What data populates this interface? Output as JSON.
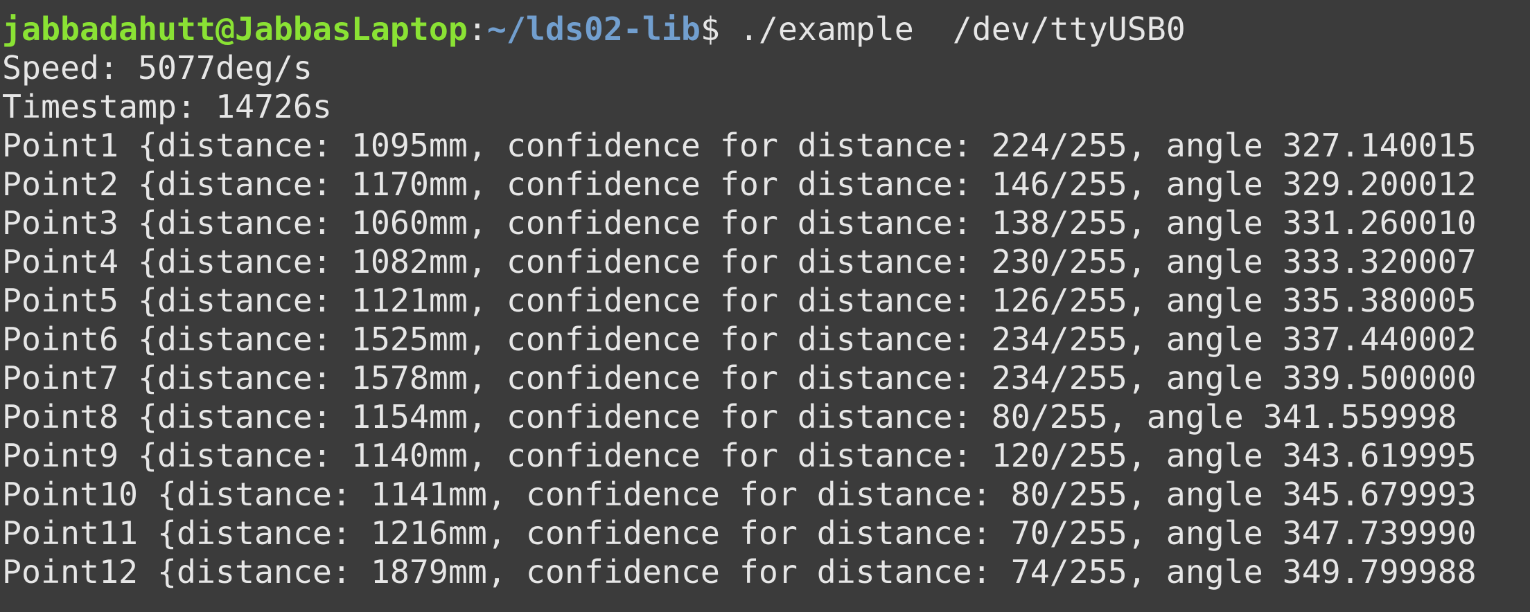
{
  "prompt": {
    "user_host": "jabbadahutt@JabbasLaptop",
    "separator": ":",
    "path": "~/lds02-lib",
    "dollar": "$ ",
    "command": "./example  /dev/ttyUSB0"
  },
  "output": [
    "Speed: 5077deg/s",
    "Timestamp: 14726s",
    "Point1 {distance: 1095mm, confidence for distance: 224/255, angle 327.140015",
    "Point2 {distance: 1170mm, confidence for distance: 146/255, angle 329.200012",
    "Point3 {distance: 1060mm, confidence for distance: 138/255, angle 331.260010",
    "Point4 {distance: 1082mm, confidence for distance: 230/255, angle 333.320007",
    "Point5 {distance: 1121mm, confidence for distance: 126/255, angle 335.380005",
    "Point6 {distance: 1525mm, confidence for distance: 234/255, angle 337.440002",
    "Point7 {distance: 1578mm, confidence for distance: 234/255, angle 339.500000",
    "Point8 {distance: 1154mm, confidence for distance: 80/255, angle 341.559998",
    "Point9 {distance: 1140mm, confidence for distance: 120/255, angle 343.619995",
    "Point10 {distance: 1141mm, confidence for distance: 80/255, angle 345.679993",
    "Point11 {distance: 1216mm, confidence for distance: 70/255, angle 347.739990",
    "Point12 {distance: 1879mm, confidence for distance: 74/255, angle 349.799988"
  ],
  "colors": {
    "background": "#3b3b3b",
    "text": "#e6e6e6",
    "user_host": "#8ae234",
    "path": "#729fcf"
  }
}
